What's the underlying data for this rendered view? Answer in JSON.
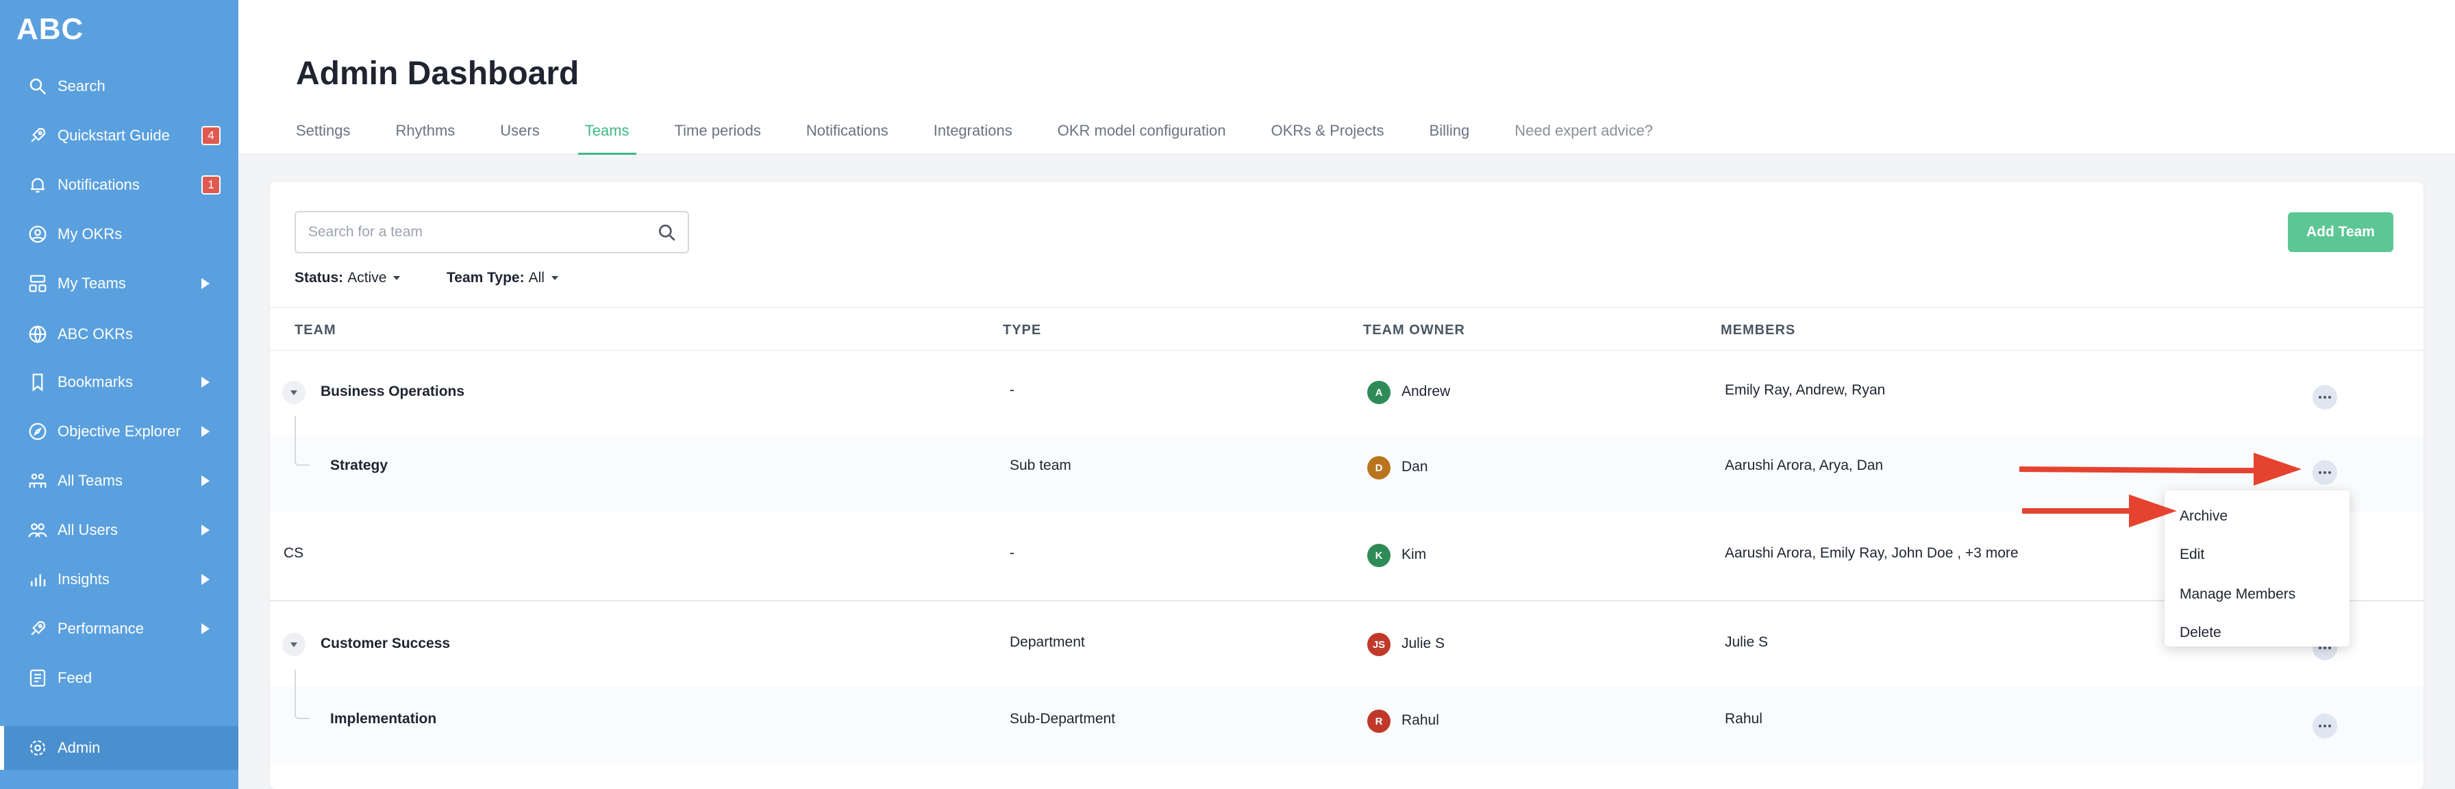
{
  "app": {
    "logo": "ABC"
  },
  "sidebar": {
    "items": [
      {
        "label": "Search",
        "icon": "search-icon"
      },
      {
        "label": "Quickstart Guide",
        "icon": "rocket-icon",
        "badge": "4"
      },
      {
        "label": "Notifications",
        "icon": "bell-icon",
        "badge": "1"
      },
      {
        "label": "My OKRs",
        "icon": "user-circle-icon"
      },
      {
        "label": "My Teams",
        "icon": "teams-icon",
        "expandable": true
      },
      {
        "label": "ABC OKRs",
        "icon": "globe-icon"
      },
      {
        "label": "Bookmarks",
        "icon": "bookmark-icon",
        "expandable": true
      },
      {
        "label": "Objective Explorer",
        "icon": "compass-icon",
        "expandable": true
      },
      {
        "label": "All Teams",
        "icon": "org-icon",
        "expandable": true
      },
      {
        "label": "All Users",
        "icon": "users-icon",
        "expandable": true
      },
      {
        "label": "Insights",
        "icon": "bar-chart-icon",
        "expandable": true
      },
      {
        "label": "Performance",
        "icon": "rocket-icon",
        "expandable": true
      },
      {
        "label": "Feed",
        "icon": "feed-icon"
      },
      {
        "label": "Admin",
        "icon": "gear-icon",
        "active": true
      }
    ]
  },
  "header": {
    "title": "Admin Dashboard",
    "tabs": [
      {
        "label": "Settings"
      },
      {
        "label": "Rhythms"
      },
      {
        "label": "Users"
      },
      {
        "label": "Teams",
        "active": true
      },
      {
        "label": "Time periods"
      },
      {
        "label": "Notifications"
      },
      {
        "label": "Integrations"
      },
      {
        "label": "OKR model configuration"
      },
      {
        "label": "OKRs & Projects"
      },
      {
        "label": "Billing"
      },
      {
        "label": "Need expert advice?"
      }
    ]
  },
  "toolbar": {
    "search_placeholder": "Search for a team",
    "add_label": "Add Team",
    "status_label": "Status:",
    "status_value": "Active",
    "type_label": "Team Type:",
    "type_value": "All"
  },
  "table": {
    "columns": [
      "TEAM",
      "TYPE",
      "TEAM OWNER",
      "MEMBERS"
    ],
    "rows": [
      {
        "team": "Business Operations",
        "type": "-",
        "owner": "Andrew",
        "owner_initial": "A",
        "owner_color": "#2e8b57",
        "members": "Emily Ray, Andrew, Ryan"
      },
      {
        "team": "Strategy",
        "type": "Sub team",
        "owner": "Dan",
        "owner_initial": "D",
        "owner_color": "#b9741e",
        "members": "Aarushi Arora, Arya, Dan"
      },
      {
        "team": "CS",
        "type": "-",
        "owner": "Kim",
        "owner_initial": "K",
        "owner_color": "#2e8b57",
        "members": "Aarushi Arora, Emily Ray, John Doe , +3 more"
      },
      {
        "team": "Customer Success",
        "type": "Department",
        "owner": "Julie S",
        "owner_initial": "JS",
        "owner_color": "#c0392b",
        "members": "Julie S"
      },
      {
        "team": "Implementation",
        "type": "Sub-Department",
        "owner": "Rahul",
        "owner_initial": "R",
        "owner_color": "#c0392b",
        "members": "Rahul"
      }
    ]
  },
  "context_menu": {
    "items": [
      "Archive",
      "Edit",
      "Manage Members",
      "Delete"
    ]
  },
  "colors": {
    "sidebar": "#5aa0df",
    "accent": "#3cb985",
    "annotation_arrow": "#e5432f"
  }
}
